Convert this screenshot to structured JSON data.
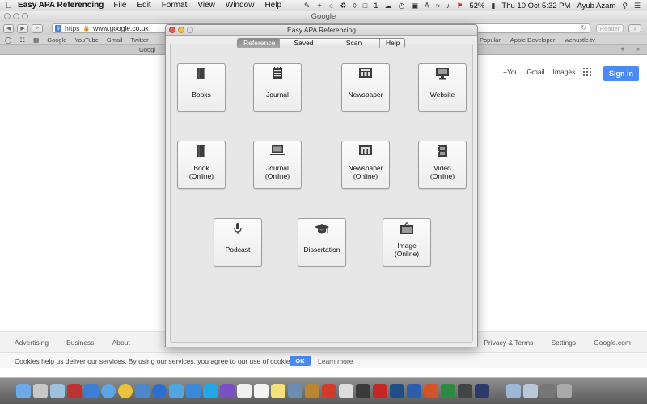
{
  "menubar": {
    "app_name": "Easy APA Referencing",
    "menus": [
      "File",
      "Edit",
      "Format",
      "View",
      "Window",
      "Help"
    ],
    "status_number": "1",
    "battery": "52%",
    "datetime": "Thu 10 Oct  5:32 PM",
    "user": "Ayub Azam"
  },
  "safari": {
    "title": "Google",
    "url_scheme": "https",
    "url": "www.google.co.uk",
    "reader_label": "Reader",
    "bookmarks": [
      "Google",
      "YouTube",
      "Gmail",
      "Twitter"
    ],
    "bookmarks_right": [
      "Popular",
      "Apple Developer",
      "wehustle.tv"
    ],
    "tab_label": "Googl"
  },
  "google": {
    "top_links": [
      "+You",
      "Gmail",
      "Images"
    ],
    "signin_label": "Sign in",
    "footer_left": [
      "Advertising",
      "Business",
      "About"
    ],
    "footer_right": [
      "Privacy & Terms",
      "Settings",
      "Google.com"
    ],
    "cookie_text": "Cookies help us deliver our services. By using our services, you agree to our use of cookies.",
    "cookie_ok": "OK",
    "cookie_learn": "Learn more"
  },
  "app": {
    "title": "Easy APA Referencing",
    "tabs": [
      "Reference",
      "Saved",
      "Scan Barcode",
      "Help"
    ],
    "active_tab": "Reference",
    "buttons": [
      {
        "label1": "Books",
        "label2": "",
        "icon": "book-icon"
      },
      {
        "label1": "Journal",
        "label2": "",
        "icon": "journal-icon"
      },
      {
        "label1": "Newspaper",
        "label2": "",
        "icon": "newspaper-icon"
      },
      {
        "label1": "Website",
        "label2": "",
        "icon": "monitor-icon"
      },
      {
        "label1": "Book",
        "label2": "(Online)",
        "icon": "book-icon"
      },
      {
        "label1": "Journal",
        "label2": "(Online)",
        "icon": "laptop-icon"
      },
      {
        "label1": "Newspaper",
        "label2": "(Online)",
        "icon": "newspaper-icon"
      },
      {
        "label1": "Video",
        "label2": "(Online)",
        "icon": "film-icon"
      },
      {
        "label1": "Podcast",
        "label2": "",
        "icon": "microphone-icon"
      },
      {
        "label1": "Dissertation",
        "label2": "",
        "icon": "graduation-cap-icon"
      },
      {
        "label1": "Image",
        "label2": "(Online)",
        "icon": "picture-icon"
      }
    ]
  }
}
